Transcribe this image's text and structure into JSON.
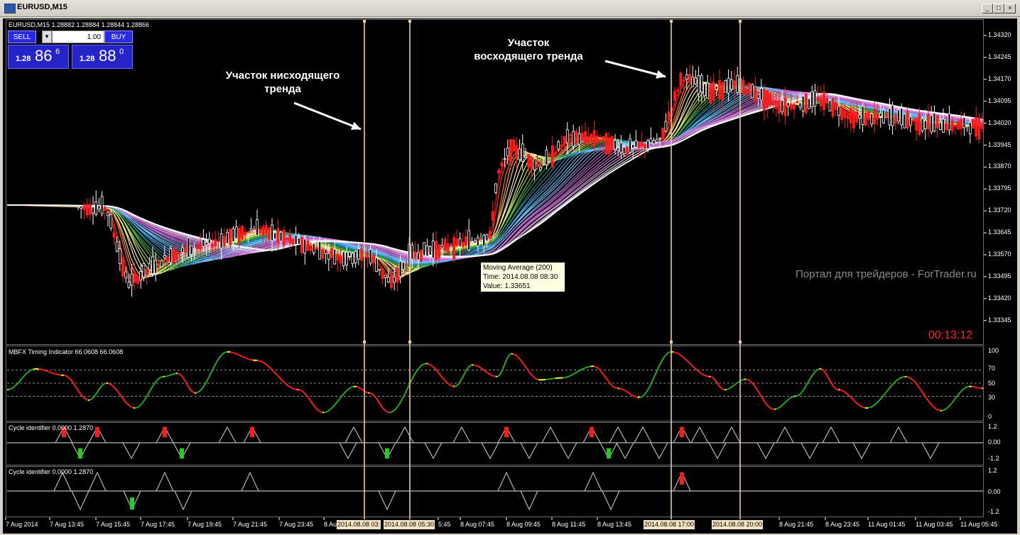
{
  "window": {
    "title": "EURUSD,M15",
    "buttons": [
      "_",
      "□",
      "×"
    ]
  },
  "main_panel": {
    "header": "EURUSD,M15  1.28882 1.28884 1.28844 1.28866",
    "y_axis": [
      "1.34320",
      "1.34245",
      "1.34170",
      "1.34095",
      "1.34020",
      "1.33945",
      "1.33870",
      "1.33795",
      "1.33720",
      "1.33645",
      "1.33570",
      "1.33495",
      "1.33420",
      "1.33345"
    ],
    "watermark": "Портал для трейдеров - ForTrader.ru",
    "timer": "00:13:12",
    "annotation_down": "Участок нисходящего\nтренда",
    "annotation_up": "Участок\nвосходящего тренда",
    "tooltip": {
      "line1": "Moving Average (200)",
      "line2": "Time: 2014.08.08 08:30",
      "line3": "Value: 1.33651"
    }
  },
  "trade_panel": {
    "sell_label": "SELL",
    "buy_label": "BUY",
    "lot": "1.00",
    "bid_small": "1.28",
    "bid_big": "86",
    "bid_sup": "6",
    "ask_small": "1.28",
    "ask_big": "88",
    "ask_sup": "0"
  },
  "mbfx_panel": {
    "header": "MBFX Timing Indicator 66.0608 66.0608",
    "y_axis": [
      "100",
      "70",
      "50",
      "30",
      "0"
    ]
  },
  "cycle_panel_1": {
    "header": "Cycle identifier 0.0000 1.2870",
    "y_axis": [
      "1.2",
      "0.00",
      "-1.2"
    ]
  },
  "cycle_panel_2": {
    "header": "Cycle identifier 0.0000 1.2870",
    "y_axis": [
      "1.2",
      "0.00",
      "-1.2"
    ]
  },
  "x_axis": [
    "7 Aug 2014",
    "7 Aug 13:45",
    "7 Aug 15:45",
    "7 Aug 17:45",
    "7 Aug 19:45",
    "7 Aug 21:45",
    "7 Aug 23:45",
    "8 Au",
    "5:45",
    "8 Aug 07:45",
    "8 Aug 09:45",
    "8 Aug 11:45",
    "8 Aug 13:45",
    "8 Aug 21:45",
    "8 Aug 23:45",
    "11 Aug 01:45",
    "11 Aug 03:45",
    "11 Aug 05:45"
  ],
  "x_axis_highlights": [
    "2014.08.08 03:",
    "2014.08.08 05:30",
    "2014.08.08 17:00",
    "2014.08.08 20:00"
  ],
  "colors": {
    "candle_up": "#ffffff",
    "candle_down": "#ff1a1a",
    "mbfx_up": "#22aa22",
    "mbfx_down": "#ff1a1a",
    "mbfx_neutral": "#ffff00",
    "vline": "#f2c89b"
  }
}
